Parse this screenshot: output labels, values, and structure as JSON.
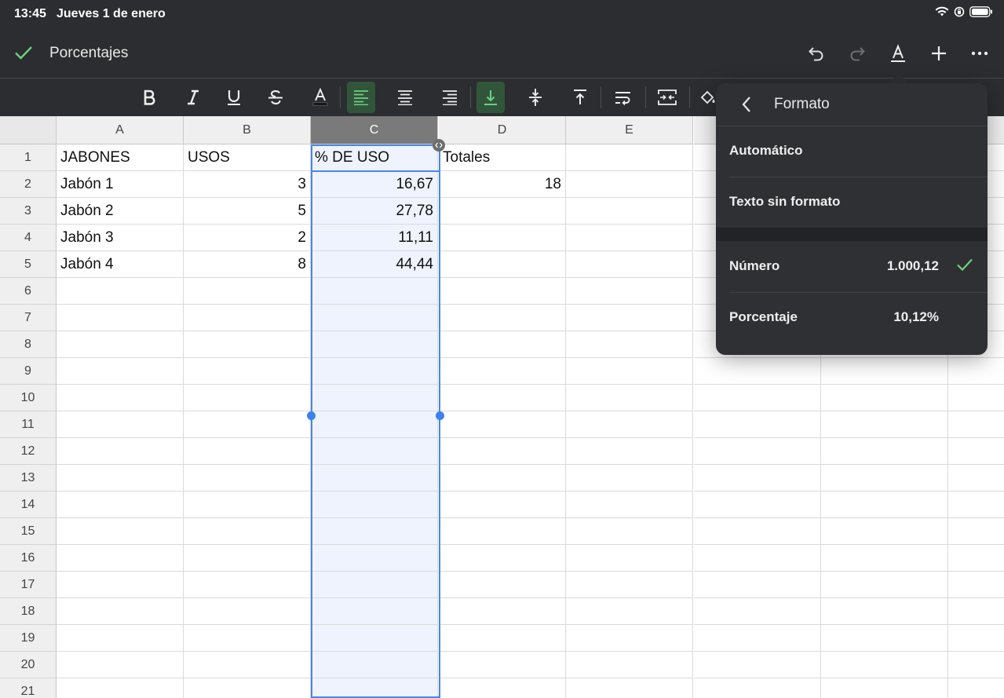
{
  "status": {
    "time": "13:45",
    "date": "Jueves 1 de enero",
    "icons": [
      "wifi-icon",
      "orientation-lock-icon",
      "battery-icon"
    ]
  },
  "doc": {
    "title": "Porcentajes"
  },
  "toolbar_icons": [
    "undo-icon",
    "redo-icon",
    "text-format-icon",
    "insert-icon",
    "more-icon"
  ],
  "format_toolbar": [
    "bold-icon",
    "italic-icon",
    "underline-icon",
    "strikethrough-icon",
    "text-color-icon",
    "align-left-icon",
    "align-center-icon",
    "align-right-icon",
    "valign-bottom-icon",
    "valign-middle-icon",
    "valign-top-icon",
    "wrap-icon",
    "merge-icon",
    "fill-color-icon"
  ],
  "colors": {
    "accent_green": "#6fcf7f",
    "selection_blue": "#4a86e8",
    "dark_bg": "#2b2d30"
  },
  "sheet": {
    "columns": [
      "A",
      "B",
      "C",
      "D",
      "E"
    ],
    "rows": [
      "1",
      "2",
      "3",
      "4",
      "5",
      "6",
      "7",
      "8",
      "9",
      "10",
      "11",
      "12",
      "13",
      "14",
      "15",
      "16",
      "17",
      "18",
      "19",
      "20",
      "21"
    ],
    "cells": {
      "A1": "JABONES",
      "B1": "USOS",
      "C1": "% DE USO",
      "D1": "Totales",
      "A2": "Jabón 1",
      "B2": "3",
      "C2": "16,67",
      "D2": "18",
      "A3": "Jabón 2",
      "B3": "5",
      "C3": "27,78",
      "A4": "Jabón 3",
      "B4": "2",
      "C4": "11,11",
      "A5": "Jabón 4",
      "B5": "8",
      "C5": "44,44"
    }
  },
  "format_panel": {
    "title": "Formato",
    "items": [
      {
        "label": "Automático",
        "value": ""
      },
      {
        "label": "Texto sin formato",
        "value": ""
      },
      {
        "label": "Número",
        "value": "1.000,12",
        "checked": true
      },
      {
        "label": "Porcentaje",
        "value": "10,12%"
      }
    ]
  }
}
